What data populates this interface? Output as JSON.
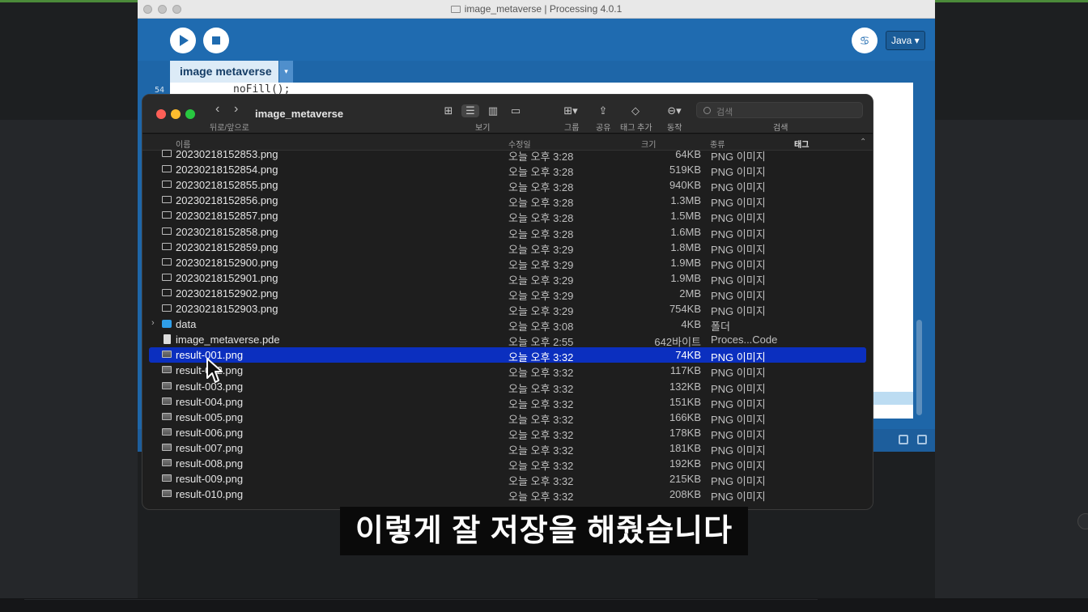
{
  "processing": {
    "window_title": "image_metaverse | Processing 4.0.1",
    "run_icon": "play-icon",
    "stop_icon": "stop-icon",
    "debug_icon": "debugger-icon",
    "mode_label": "Java ▾",
    "tab_label": "image metaverse",
    "tab_menu": "▾",
    "line_number": "54",
    "code_line": "noFill();"
  },
  "finder": {
    "title": "image_metaverse",
    "nav_label": "뒤로/앞으로",
    "toolbar_labels": {
      "view": "보기",
      "group": "그룹",
      "share": "공유",
      "tag": "태그 추가",
      "action": "동작",
      "search": "검색"
    },
    "search_placeholder": "검색",
    "columns": {
      "name": "이름",
      "modified": "수정일",
      "size": "크기",
      "kind": "종류",
      "tags": "태그"
    },
    "files": [
      {
        "name": "20230218152853.png",
        "modified": "오늘 오후 3:28",
        "size": "64KB",
        "kind": "PNG 이미지",
        "icon": "image-file-icon"
      },
      {
        "name": "20230218152854.png",
        "modified": "오늘 오후 3:28",
        "size": "519KB",
        "kind": "PNG 이미지",
        "icon": "image-file-icon"
      },
      {
        "name": "20230218152855.png",
        "modified": "오늘 오후 3:28",
        "size": "940KB",
        "kind": "PNG 이미지",
        "icon": "image-file-icon"
      },
      {
        "name": "20230218152856.png",
        "modified": "오늘 오후 3:28",
        "size": "1.3MB",
        "kind": "PNG 이미지",
        "icon": "image-file-icon"
      },
      {
        "name": "20230218152857.png",
        "modified": "오늘 오후 3:28",
        "size": "1.5MB",
        "kind": "PNG 이미지",
        "icon": "image-file-icon"
      },
      {
        "name": "20230218152858.png",
        "modified": "오늘 오후 3:28",
        "size": "1.6MB",
        "kind": "PNG 이미지",
        "icon": "image-file-icon"
      },
      {
        "name": "20230218152859.png",
        "modified": "오늘 오후 3:29",
        "size": "1.8MB",
        "kind": "PNG 이미지",
        "icon": "image-file-icon"
      },
      {
        "name": "20230218152900.png",
        "modified": "오늘 오후 3:29",
        "size": "1.9MB",
        "kind": "PNG 이미지",
        "icon": "image-file-icon"
      },
      {
        "name": "20230218152901.png",
        "modified": "오늘 오후 3:29",
        "size": "1.9MB",
        "kind": "PNG 이미지",
        "icon": "image-file-icon"
      },
      {
        "name": "20230218152902.png",
        "modified": "오늘 오후 3:29",
        "size": "2MB",
        "kind": "PNG 이미지",
        "icon": "image-file-icon"
      },
      {
        "name": "20230218152903.png",
        "modified": "오늘 오후 3:29",
        "size": "754KB",
        "kind": "PNG 이미지",
        "icon": "image-file-icon"
      },
      {
        "name": "data",
        "modified": "오늘 오후 3:08",
        "size": "4KB",
        "kind": "폴더",
        "icon": "folder-icon"
      },
      {
        "name": "image_metaverse.pde",
        "modified": "오늘 오후 2:55",
        "size": "642바이트",
        "kind": "Proces...Code",
        "icon": "document-icon"
      },
      {
        "name": "result-001.png",
        "modified": "오늘 오후 3:32",
        "size": "74KB",
        "kind": "PNG 이미지",
        "icon": "image-thumbnail-icon",
        "selected": true
      },
      {
        "name": "result-002.png",
        "modified": "오늘 오후 3:32",
        "size": "117KB",
        "kind": "PNG 이미지",
        "icon": "image-thumbnail-icon"
      },
      {
        "name": "result-003.png",
        "modified": "오늘 오후 3:32",
        "size": "132KB",
        "kind": "PNG 이미지",
        "icon": "image-thumbnail-icon"
      },
      {
        "name": "result-004.png",
        "modified": "오늘 오후 3:32",
        "size": "151KB",
        "kind": "PNG 이미지",
        "icon": "image-thumbnail-icon"
      },
      {
        "name": "result-005.png",
        "modified": "오늘 오후 3:32",
        "size": "166KB",
        "kind": "PNG 이미지",
        "icon": "image-thumbnail-icon"
      },
      {
        "name": "result-006.png",
        "modified": "오늘 오후 3:32",
        "size": "178KB",
        "kind": "PNG 이미지",
        "icon": "image-thumbnail-icon"
      },
      {
        "name": "result-007.png",
        "modified": "오늘 오후 3:32",
        "size": "181KB",
        "kind": "PNG 이미지",
        "icon": "image-thumbnail-icon"
      },
      {
        "name": "result-008.png",
        "modified": "오늘 오후 3:32",
        "size": "192KB",
        "kind": "PNG 이미지",
        "icon": "image-thumbnail-icon"
      },
      {
        "name": "result-009.png",
        "modified": "오늘 오후 3:32",
        "size": "215KB",
        "kind": "PNG 이미지",
        "icon": "image-thumbnail-icon"
      },
      {
        "name": "result-010.png",
        "modified": "오늘 오후 3:32",
        "size": "208KB",
        "kind": "PNG 이미지",
        "icon": "image-thumbnail-icon"
      }
    ]
  },
  "subtitle": "이렇게 잘 저장을 해줬습니다",
  "colors": {
    "processing_blue": "#1e66a8",
    "selection_blue": "#0b2fbf",
    "finder_bg": "#1e1e1e"
  }
}
